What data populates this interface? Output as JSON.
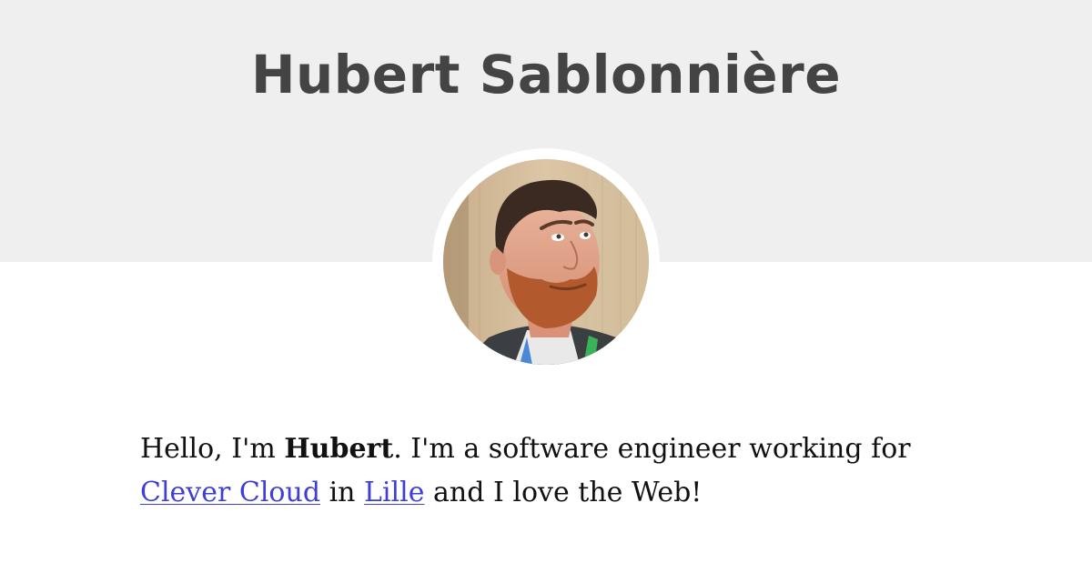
{
  "header": {
    "title": "Hubert Sablonnière"
  },
  "avatar": {
    "icon": "profile-photo"
  },
  "intro": {
    "greeting": "Hello, I'm ",
    "name": "Hubert",
    "after_name": ". I'm a software engineer working for ",
    "company_link": "Clever Cloud",
    "in_text": " in ",
    "city_link": "Lille",
    "closing": " and I love the Web!"
  },
  "colors": {
    "header_background": "#efefef",
    "title_text": "#444444",
    "body_text": "#111111",
    "link": "#3f3fd6"
  }
}
